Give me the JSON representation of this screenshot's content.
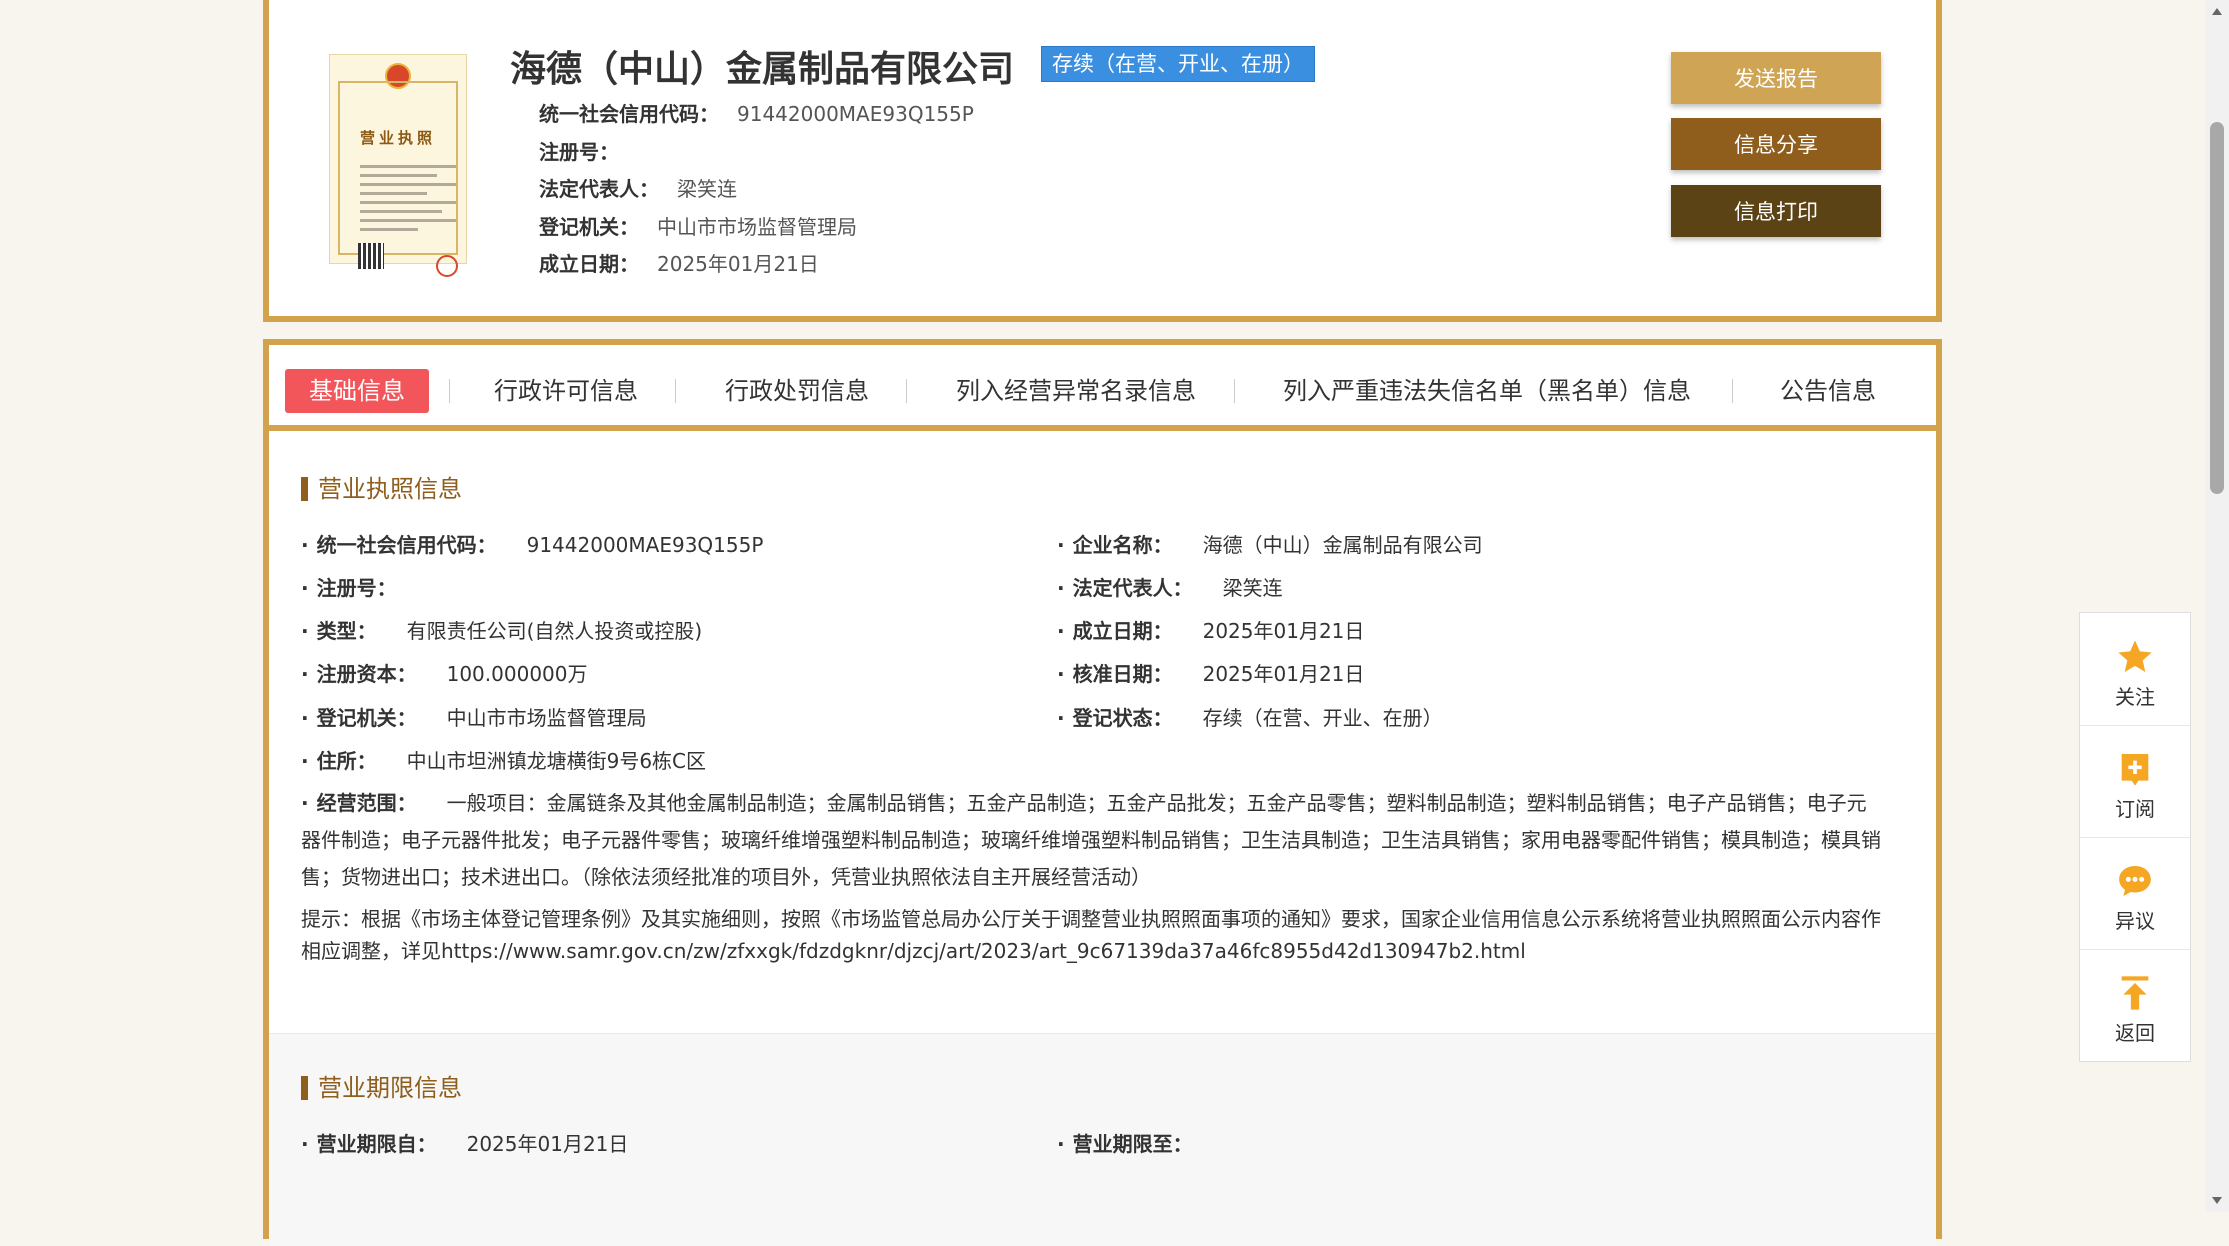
{
  "company": {
    "name": "海德（中山）金属制品有限公司",
    "status": "存续（在营、开业、在册）"
  },
  "certificate": {
    "title": "营业执照"
  },
  "header_info": [
    {
      "label": "统一社会信用代码：",
      "value": "91442000MAE93Q155P"
    },
    {
      "label": "注册号：",
      "value": ""
    },
    {
      "label": "法定代表人：",
      "value": "梁笑连"
    },
    {
      "label": "登记机关：",
      "value": "中山市市场监督管理局"
    },
    {
      "label": "成立日期：",
      "value": "2025年01月21日"
    }
  ],
  "actions": {
    "report": "发送报告",
    "share": "信息分享",
    "print": "信息打印"
  },
  "tabs": [
    {
      "label": "基础信息",
      "active": true
    },
    {
      "label": "行政许可信息"
    },
    {
      "label": "行政处罚信息"
    },
    {
      "label": "列入经营异常名录信息"
    },
    {
      "label": "列入严重违法失信名单（黑名单）信息"
    },
    {
      "label": "公告信息"
    }
  ],
  "license_section": {
    "title": "营业执照信息",
    "fields": [
      {
        "label": "统一社会信用代码：",
        "value": "91442000MAE93Q155P"
      },
      {
        "label": "企业名称：",
        "value": "海德（中山）金属制品有限公司"
      },
      {
        "label": "注册号：",
        "value": ""
      },
      {
        "label": "法定代表人：",
        "value": "梁笑连"
      },
      {
        "label": "类型：",
        "value": "有限责任公司(自然人投资或控股)"
      },
      {
        "label": "成立日期：",
        "value": "2025年01月21日"
      },
      {
        "label": "注册资本：",
        "value": "100.000000万"
      },
      {
        "label": "核准日期：",
        "value": "2025年01月21日"
      },
      {
        "label": "登记机关：",
        "value": "中山市市场监督管理局"
      },
      {
        "label": "登记状态：",
        "value": "存续（在营、开业、在册）"
      },
      {
        "label": "住所：",
        "value": "中山市坦洲镇龙塘横街9号6栋C区"
      }
    ],
    "scope_label": "经营范围：",
    "scope_value": "一般项目：金属链条及其他金属制品制造；金属制品销售；五金产品制造；五金产品批发；五金产品零售；塑料制品制造；塑料制品销售；电子产品销售；电子元器件制造；电子元器件批发；电子元器件零售；玻璃纤维增强塑料制品制造；玻璃纤维增强塑料制品销售；卫生洁具制造；卫生洁具销售；家用电器零配件销售；模具制造；模具销售；货物进出口；技术进出口。（除依法须经批准的项目外，凭营业执照依法自主开展经营活动）",
    "tip": "提示：根据《市场主体登记管理条例》及其实施细则，按照《市场监管总局办公厅关于调整营业执照照面事项的通知》要求，国家企业信用信息公示系统将营业执照照面公示内容作相应调整，详见https://www.samr.gov.cn/zw/zfxxgk/fdzdgknr/djzcj/art/2023/art_9c67139da37a46fc8955d42d130947b2.html"
  },
  "term_section": {
    "title": "营业期限信息",
    "from_label": "营业期限自：",
    "from_value": "2025年01月21日",
    "to_label": "营业期限至：",
    "to_value": ""
  },
  "side_dock": [
    {
      "label": "关注",
      "icon": "star-icon"
    },
    {
      "label": "订阅",
      "icon": "add-subscribe-icon"
    },
    {
      "label": "异议",
      "icon": "chat-bubble-icon"
    },
    {
      "label": "返回",
      "icon": "back-to-top-icon"
    }
  ],
  "colors": {
    "frame_gold": "#d2a34c",
    "active_tab": "#f2555a",
    "status_badge": "#3b8fe0",
    "section_brown": "#8f5e1c",
    "dock_icon_orange": "#f5a623"
  }
}
